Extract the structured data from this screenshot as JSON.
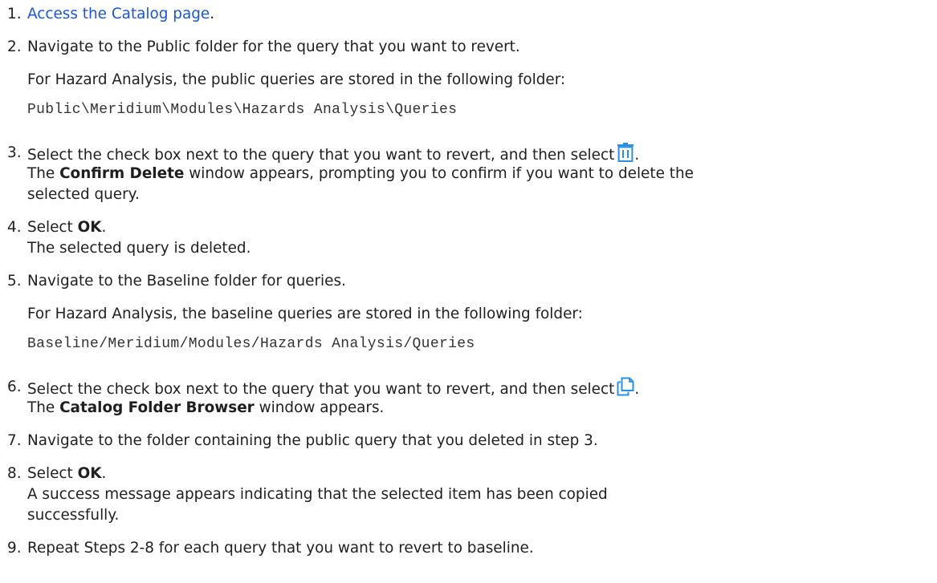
{
  "steps": [
    {
      "number": "1.",
      "link_text": "Access the Catalog page",
      "after_link": "."
    },
    {
      "number": "2.",
      "text": "Navigate to the Public folder for the query that you want to revert.",
      "note": "For Hazard Analysis, the public queries are stored in the following folder:",
      "path": "Public\\Meridium\\Modules\\Hazards Analysis\\Queries"
    },
    {
      "number": "3.",
      "text": "Select the check box next to the query that you want to revert, and then select",
      "end_punct": ".",
      "result_bold": "Confirm Delete",
      "result_rest": " window appears, prompting you to confirm if you want to delete the",
      "result_line2": "selected query.",
      "icon": "trash-icon"
    },
    {
      "number": "4.",
      "prefix": "Select ",
      "bold": "OK",
      "suffix": ".",
      "result": "The selected query is deleted."
    },
    {
      "number": "5.",
      "text": "Navigate to the Baseline folder for queries.",
      "note": "For Hazard Analysis, the baseline queries are stored in the following folder:",
      "path": "Baseline/Meridium/Modules/Hazards Analysis/Queries"
    },
    {
      "number": "6.",
      "text": "Select the check box next to the query that you want to revert, and then select",
      "end_punct": ".",
      "result_bold": "Catalog Folder Browser",
      "result_rest": " window appears.",
      "icon": "copy-icon"
    },
    {
      "number": "7.",
      "text": "Navigate to the folder containing the public query that you deleted in step 3."
    },
    {
      "number": "8.",
      "prefix": "Select ",
      "bold": "OK",
      "suffix": ".",
      "result_line1": "A success message appears indicating that the selected item has been copied",
      "result_line2": "successfully."
    },
    {
      "number": "9.",
      "text": "Repeat Steps 2-8 for each query that you want to revert to baseline."
    }
  ],
  "common": {
    "the": "The "
  },
  "colors": {
    "link": "#1a56d6",
    "icon": "#2b8fe0",
    "text": "#1f1f1f"
  }
}
